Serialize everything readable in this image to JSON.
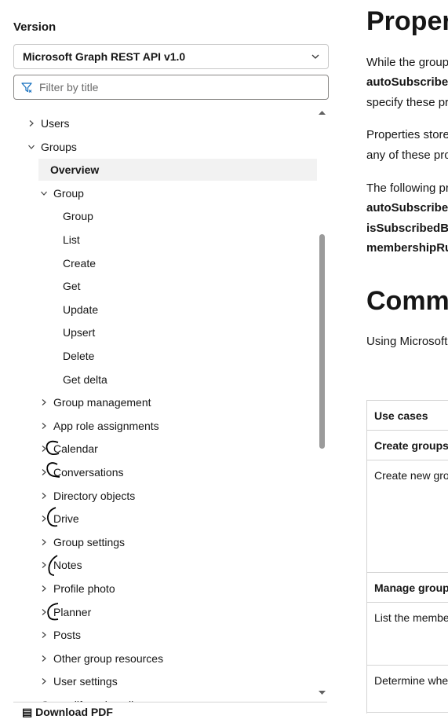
{
  "sidebar": {
    "version_label": "Version",
    "version_selected": "Microsoft Graph REST API v1.0",
    "filter_placeholder": "Filter by title",
    "download_pdf": "Download PDF",
    "toc": [
      {
        "label": "Users",
        "arrow": "right",
        "indent": 1
      },
      {
        "label": "Groups",
        "arrow": "down",
        "indent": 1
      },
      {
        "label": "Overview",
        "arrow": "none",
        "indent": 2,
        "selected": true
      },
      {
        "label": "Group",
        "arrow": "down",
        "indent": 2
      },
      {
        "label": "Group",
        "arrow": "none",
        "indent": 3
      },
      {
        "label": "List",
        "arrow": "none",
        "indent": 3
      },
      {
        "label": "Create",
        "arrow": "none",
        "indent": 3
      },
      {
        "label": "Get",
        "arrow": "none",
        "indent": 3
      },
      {
        "label": "Update",
        "arrow": "none",
        "indent": 3
      },
      {
        "label": "Upsert",
        "arrow": "none",
        "indent": 3
      },
      {
        "label": "Delete",
        "arrow": "none",
        "indent": 3
      },
      {
        "label": "Get delta",
        "arrow": "none",
        "indent": 3
      },
      {
        "label": "Group management",
        "arrow": "right",
        "indent": 2
      },
      {
        "label": "App role assignments",
        "arrow": "right",
        "indent": 2
      },
      {
        "label": "Calendar",
        "arrow": "right",
        "indent": 2
      },
      {
        "label": "Conversations",
        "arrow": "right",
        "indent": 2
      },
      {
        "label": "Directory objects",
        "arrow": "right",
        "indent": 2
      },
      {
        "label": "Drive",
        "arrow": "right",
        "indent": 2
      },
      {
        "label": "Group settings",
        "arrow": "right",
        "indent": 2
      },
      {
        "label": "Notes",
        "arrow": "right",
        "indent": 2
      },
      {
        "label": "Profile photo",
        "arrow": "right",
        "indent": 2
      },
      {
        "label": "Planner",
        "arrow": "right",
        "indent": 2
      },
      {
        "label": "Posts",
        "arrow": "right",
        "indent": 2
      },
      {
        "label": "Other group resources",
        "arrow": "right",
        "indent": 2
      },
      {
        "label": "User settings",
        "arrow": "right",
        "indent": 2
      },
      {
        "label": "Group lifecycle policy",
        "arrow": "right",
        "indent": 1
      }
    ]
  },
  "main": {
    "heading1": "Properties",
    "para1": [
      "While the group",
      "autoSubscribeNewMembers",
      "specify these properties"
    ],
    "para2": [
      "Properties stored",
      "any of these properties"
    ],
    "para3": [
      "The following properties",
      "autoSubscribeNewMembers",
      "isSubscribedByMail",
      "membershipRule"
    ],
    "heading2": "Common use cases",
    "para4": "Using Microsoft Graph",
    "table": {
      "header": "Use cases",
      "rows": [
        "Create groups,",
        "Create new groups",
        "Manage groups",
        "List the members",
        "Determine whether"
      ]
    }
  }
}
